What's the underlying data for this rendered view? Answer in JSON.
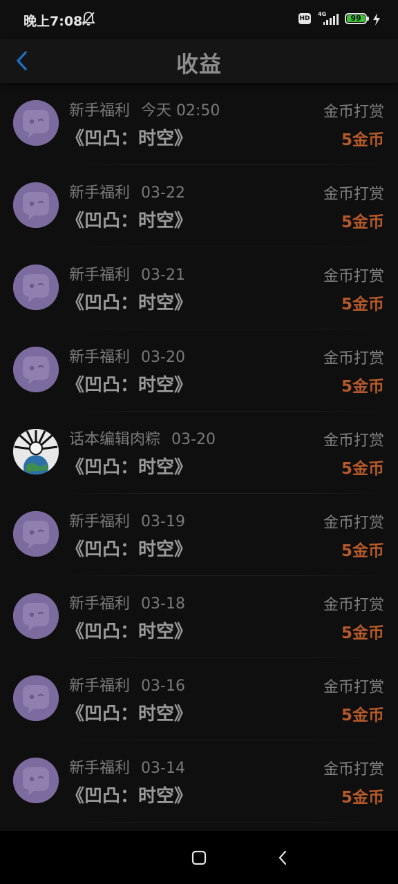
{
  "status_bar": {
    "time": "晚上7:08",
    "hd": "HD",
    "network": "4G",
    "battery": "99",
    "battery_level": 0.99,
    "icons": [
      "bell-off-icon",
      "signal-icon",
      "battery-icon",
      "charging-icon"
    ]
  },
  "header": {
    "title": "收益",
    "back_icon": "chevron-left-icon"
  },
  "colors": {
    "background": "#0f0f0f",
    "amount": "#b5592a",
    "back_arrow": "#1e6fc0",
    "avatar_purple": "#7b6b9e"
  },
  "records": [
    {
      "sender": "新手福利",
      "date": "今天 02:50",
      "title": "《凹凸：时空》",
      "type": "金币打赏",
      "amount": "5金币",
      "avatar": "chat-bot-avatar"
    },
    {
      "sender": "新手福利",
      "date": "03-22",
      "title": "《凹凸：时空》",
      "type": "金币打赏",
      "amount": "5金币",
      "avatar": "chat-bot-avatar"
    },
    {
      "sender": "新手福利",
      "date": "03-21",
      "title": "《凹凸：时空》",
      "type": "金币打赏",
      "amount": "5金币",
      "avatar": "chat-bot-avatar"
    },
    {
      "sender": "新手福利",
      "date": "03-20",
      "title": "《凹凸：时空》",
      "type": "金币打赏",
      "amount": "5金币",
      "avatar": "chat-bot-avatar"
    },
    {
      "sender": "话本编辑肉粽",
      "date": "03-20",
      "title": "《凹凸：时空》",
      "type": "金币打赏",
      "amount": "5金币",
      "avatar": "editor-photo-avatar"
    },
    {
      "sender": "新手福利",
      "date": "03-19",
      "title": "《凹凸：时空》",
      "type": "金币打赏",
      "amount": "5金币",
      "avatar": "chat-bot-avatar"
    },
    {
      "sender": "新手福利",
      "date": "03-18",
      "title": "《凹凸：时空》",
      "type": "金币打赏",
      "amount": "5金币",
      "avatar": "chat-bot-avatar"
    },
    {
      "sender": "新手福利",
      "date": "03-16",
      "title": "《凹凸：时空》",
      "type": "金币打赏",
      "amount": "5金币",
      "avatar": "chat-bot-avatar"
    },
    {
      "sender": "新手福利",
      "date": "03-14",
      "title": "《凹凸：时空》",
      "type": "金币打赏",
      "amount": "5金币",
      "avatar": "chat-bot-avatar"
    }
  ],
  "nav_bar": {
    "home_icon": "square-home-icon",
    "back_icon": "chevron-left-icon"
  }
}
